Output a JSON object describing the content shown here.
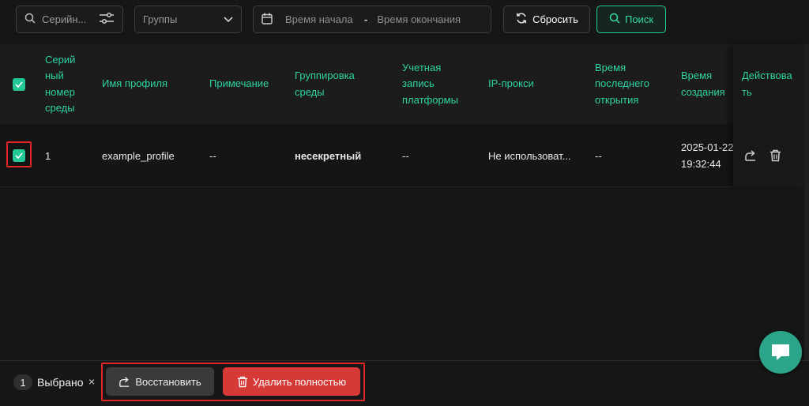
{
  "toolbar": {
    "serial_placeholder": "Серийн...",
    "group_placeholder": "Группы",
    "start_placeholder": "Время начала",
    "separator": "-",
    "end_placeholder": "Время окончания",
    "reset_label": "Сбросить",
    "search_label": "Поиск"
  },
  "table": {
    "headers": {
      "serial": [
        "Серий",
        "ный",
        "номер",
        "среды"
      ],
      "profile": "Имя профиля",
      "note": "Примечание",
      "group": [
        "Группировка",
        "среды"
      ],
      "account": [
        "Учетная",
        "запись",
        "платформы"
      ],
      "proxy": "IP-прокси",
      "last_open": [
        "Время",
        "последнего",
        "открытия"
      ],
      "created": [
        "Время",
        "создания"
      ],
      "actions": [
        "Действова",
        "ть"
      ]
    },
    "rows": [
      {
        "serial": "1",
        "profile": "example_profile",
        "note": "--",
        "group": "несекретный",
        "account": "--",
        "proxy": "Не использоват...",
        "last_open": "--",
        "created_date": "2025-01-22",
        "created_time": "19:32:44"
      }
    ]
  },
  "footer": {
    "count": "1",
    "selected_label": "Выбрано",
    "close": "×",
    "restore_label": "Восстановить",
    "delete_label": "Удалить полностью"
  },
  "colors": {
    "accent": "#2ed3a3",
    "danger": "#d63a36",
    "highlight": "#e22626"
  },
  "icons": [
    "search-icon",
    "filter-icon",
    "chevron-down-icon",
    "calendar-icon",
    "refresh-icon",
    "share-icon",
    "trash-icon",
    "chat-icon",
    "check-icon"
  ]
}
